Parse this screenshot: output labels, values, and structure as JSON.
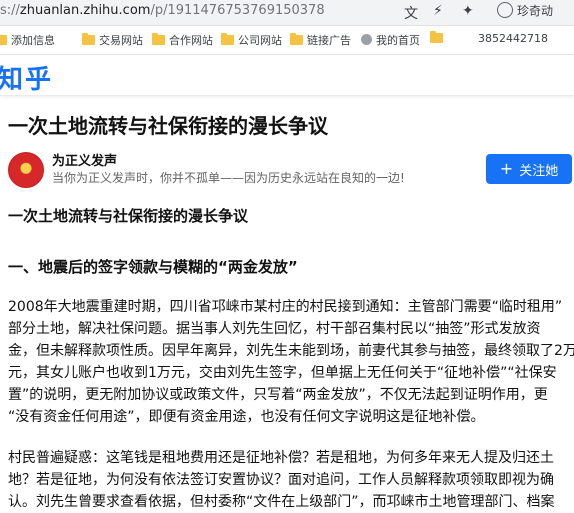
{
  "browser": {
    "url_dim_prefix": "s://",
    "url_host": "zhuanlan.zhihu.com",
    "url_path": "/p/1911476753769150378",
    "profile_label": "珍奇动"
  },
  "bookmarks": [
    {
      "label": "添加信息",
      "icon": "folder-icon"
    },
    {
      "label": "交易网站",
      "icon": "folder-icon"
    },
    {
      "label": "合作网站",
      "icon": "folder-icon"
    },
    {
      "label": "公司网站",
      "icon": "folder-icon"
    },
    {
      "label": "链接广告",
      "icon": "folder-icon"
    },
    {
      "label": "我的首页",
      "icon": "globe-icon"
    },
    {
      "label": "",
      "icon": "folder-icon"
    },
    {
      "label": "3852442718",
      "icon": ""
    }
  ],
  "header": {
    "logo": "知乎"
  },
  "article": {
    "title": "一次土地流转与社保衔接的漫长争议",
    "author": {
      "name": "为正义发声",
      "bio": "当你为正义发声时，你并不孤单——因为历史永远站在良知的一边!"
    },
    "follow_label": "关注她",
    "subtitle": "一次土地流转与社保衔接的漫长争议",
    "section1_heading": "一、地震后的签字领款与模糊的“两金发放”",
    "para1_lines": [
      "2008年大地震重建时期，四川省邛崃市某村庄的村民接到通知：主管部门需要“临时租用”",
      "部分土地，解决社保问题。据当事人刘先生回忆，村干部召集村民以“抽签”形式发放资",
      "金，但未解释款项性质。因早年离异，刘先生未能到场，前妻代其参与抽签，最终领取了2万",
      "元，其女儿账户也收到1万元，交由刘先生签字，但单据上无任何关于“征地补偿”“社保安",
      "置”的说明，更无附加协议或政策文件，只写着“两金发放”，不仅无法起到证明作用，更",
      "“没有资金任何用途”，即便有资金用途，也没有任何文字说明这是征地补偿。"
    ],
    "para2_lines": [
      "村民普遍疑惑：这笔钱是租地费用还是征地补偿？若是租地，为何多年来无人提及归还土",
      "地？若是征地，为何没有依法签订安置协议？面对追问，工作人员解释款项领取即视为确",
      "认。刘先生曾要求查看依据，但村委称“文件在上级部门”，而邛崃市土地管理部门、档案"
    ]
  }
}
